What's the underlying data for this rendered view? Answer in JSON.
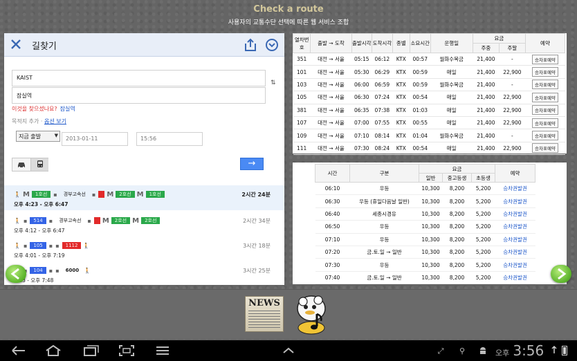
{
  "header": {
    "title": "Check a route",
    "subtitle": "사용자의 교통수단 선택에 따른 웹 서비스 조합"
  },
  "maps": {
    "close_icon": "close-icon",
    "title": "길찾기",
    "share_icon": "share-icon",
    "menu_icon": "chevron-down-icon",
    "from_value": "KAIST",
    "to_value": "잠실역",
    "swap_icon": "⇅",
    "did_you_mean": "이것을 찾으셨나요?",
    "did_you_mean_link": "잠실역",
    "add_destination": "목적지 추가",
    "add_separator": " · ",
    "options_link": "옵션 보기",
    "depart_option": "지금 출발",
    "date_value": "2013-01-11",
    "time_value": "15:56",
    "go_icon": "→",
    "routes": [
      {
        "line_chips": [
          "1호선",
          "경부고속선",
          "2호선",
          "1호선",
          "2호선"
        ],
        "times": "오후 4:23 - 오후 6:47",
        "duration": "2시간 24분"
      },
      {
        "line_chips": [
          "514",
          "경부고속선",
          "2호선",
          "2호선"
        ],
        "times": "오후 4:12 - 오후 6:47",
        "duration": "2시간 34분"
      },
      {
        "line_chips": [
          "105",
          "1112"
        ],
        "times": "오후 4:01 - 오후 7:19",
        "duration": "3시간 18분"
      },
      {
        "line_chips": [
          "104",
          "6000"
        ],
        "times": "4:23 - 오후 7:48",
        "duration": "3시간 25분"
      }
    ]
  },
  "train_table": {
    "headers": {
      "train_no": "열차번호",
      "route": "출발 → 도착",
      "depart": "출발시각",
      "arrive": "도착시각",
      "type": "종별",
      "duration": "소요시간",
      "days": "운행일",
      "fare": "요금",
      "weekday": "주중",
      "weekend": "주말",
      "reserve": "예약"
    },
    "reserve_label": "승차표예약",
    "rows": [
      {
        "no": "351",
        "route": "대전 → 서울",
        "dep": "05:15",
        "arr": "06:12",
        "type": "KTX",
        "dur": "00:57",
        "days": "월화수목금",
        "weekday": "21,400",
        "weekend": "-"
      },
      {
        "no": "101",
        "route": "대전 → 서울",
        "dep": "05:30",
        "arr": "06:29",
        "type": "KTX",
        "dur": "00:59",
        "days": "매일",
        "weekday": "21,400",
        "weekend": "22,900"
      },
      {
        "no": "103",
        "route": "대전 → 서울",
        "dep": "06:00",
        "arr": "06:59",
        "type": "KTX",
        "dur": "00:59",
        "days": "월화수목금",
        "weekday": "21,400",
        "weekend": "-"
      },
      {
        "no": "105",
        "route": "대전 → 서울",
        "dep": "06:30",
        "arr": "07:24",
        "type": "KTX",
        "dur": "00:54",
        "days": "매일",
        "weekday": "21,400",
        "weekend": "22,900"
      },
      {
        "no": "381",
        "route": "대전 → 서울",
        "dep": "06:35",
        "arr": "07:38",
        "type": "KTX",
        "dur": "01:03",
        "days": "매일",
        "weekday": "21,400",
        "weekend": "22,900"
      },
      {
        "no": "107",
        "route": "대전 → 서울",
        "dep": "07:00",
        "arr": "07:55",
        "type": "KTX",
        "dur": "00:55",
        "days": "매일",
        "weekday": "21,400",
        "weekend": "22,900"
      },
      {
        "no": "109",
        "route": "대전 → 서울",
        "dep": "07:10",
        "arr": "08:14",
        "type": "KTX",
        "dur": "01:04",
        "days": "월화수목금",
        "weekday": "21,400",
        "weekend": "-"
      },
      {
        "no": "111",
        "route": "대전 → 서울",
        "dep": "07:30",
        "arr": "08:24",
        "type": "KTX",
        "dur": "00:54",
        "days": "매일",
        "weekday": "21,400",
        "weekend": "22,900"
      }
    ]
  },
  "bus_table": {
    "headers": {
      "time": "시간",
      "section": "구분",
      "fare": "요금",
      "general": "일반",
      "student": "중고등생",
      "child": "초등생",
      "reserve": "예약"
    },
    "link_label": "승차권발권",
    "rows": [
      {
        "time": "06:10",
        "section": "우등",
        "general": "10,300",
        "student": "8,200",
        "child": "5,200"
      },
      {
        "time": "06:30",
        "section": "우등 (휴일다음날 일반)",
        "general": "10,300",
        "student": "8,200",
        "child": "5,200"
      },
      {
        "time": "06:40",
        "section": "세종시경유",
        "general": "10,300",
        "student": "8,200",
        "child": "5,200"
      },
      {
        "time": "06:50",
        "section": "우등",
        "general": "10,300",
        "student": "8,200",
        "child": "5,200"
      },
      {
        "time": "07:10",
        "section": "우등",
        "general": "10,300",
        "student": "8,200",
        "child": "5,200"
      },
      {
        "time": "07:20",
        "section": "금.토.일 → 일반",
        "general": "10,300",
        "student": "8,200",
        "child": "5,200"
      },
      {
        "time": "07:30",
        "section": "우등",
        "general": "10,300",
        "student": "8,200",
        "child": "5,200"
      },
      {
        "time": "07:40",
        "section": "금.토.일 → 일반",
        "general": "10,300",
        "student": "8,200",
        "child": "5,200"
      }
    ]
  },
  "dock": {
    "news_label": "NEWS"
  },
  "system_bar": {
    "ampm": "오후",
    "time": "3:56"
  },
  "colors": {
    "accent_blue": "#4a8af4",
    "ktx_orange": "#f0872d",
    "line_green": "#2aa84a",
    "bus_blue": "#3464e6",
    "bus_red": "#e22a2a",
    "link_blue": "#1a55c9"
  }
}
